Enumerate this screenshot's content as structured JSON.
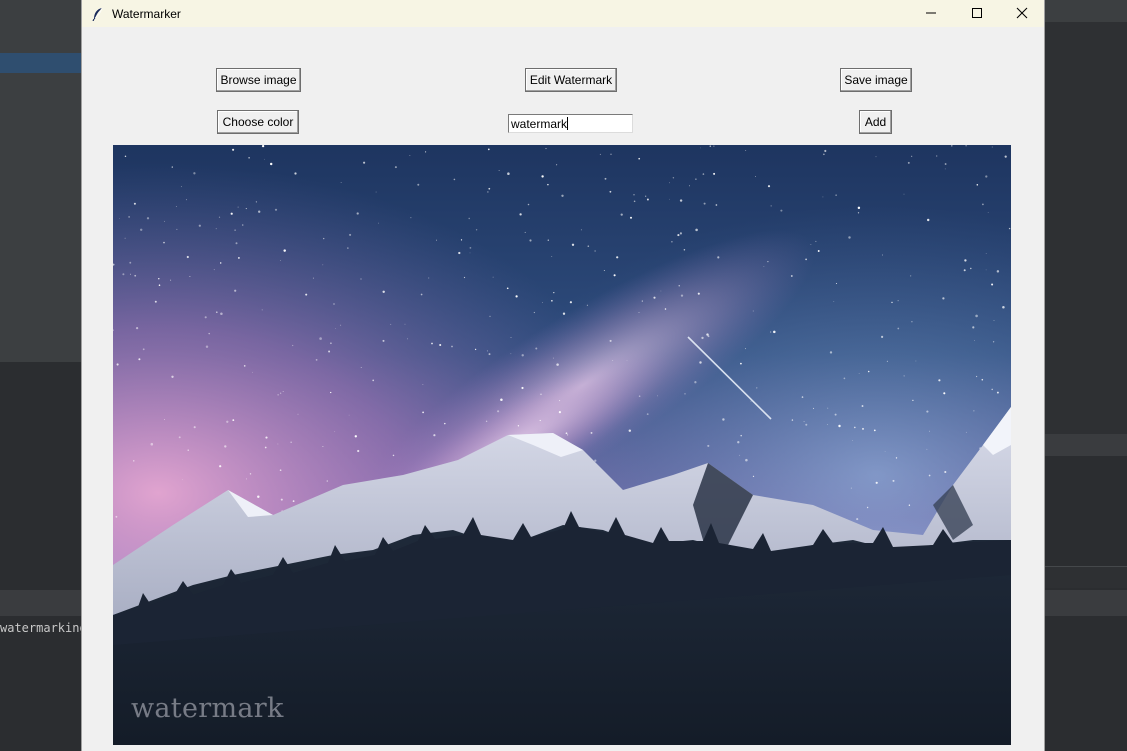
{
  "window": {
    "title": "Watermarker",
    "controls": {
      "minimize": "minimize-icon",
      "maximize": "maximize-icon",
      "close": "close-icon"
    }
  },
  "toolbar": {
    "browse_label": "Browse image",
    "edit_label": "Edit Watermark",
    "save_label": "Save image",
    "color_label": "Choose color",
    "add_label": "Add"
  },
  "watermark_entry": {
    "value": "watermark"
  },
  "canvas": {
    "overlay_text": "watermark",
    "image_description_icon": "mountain-night-photo"
  },
  "background": {
    "editor_snippet": "watermarking"
  },
  "colors": {
    "window_bg": "#f0f0f0",
    "titlebar_bg": "#f7f5e4",
    "ide_bg": "#2b2d30"
  }
}
